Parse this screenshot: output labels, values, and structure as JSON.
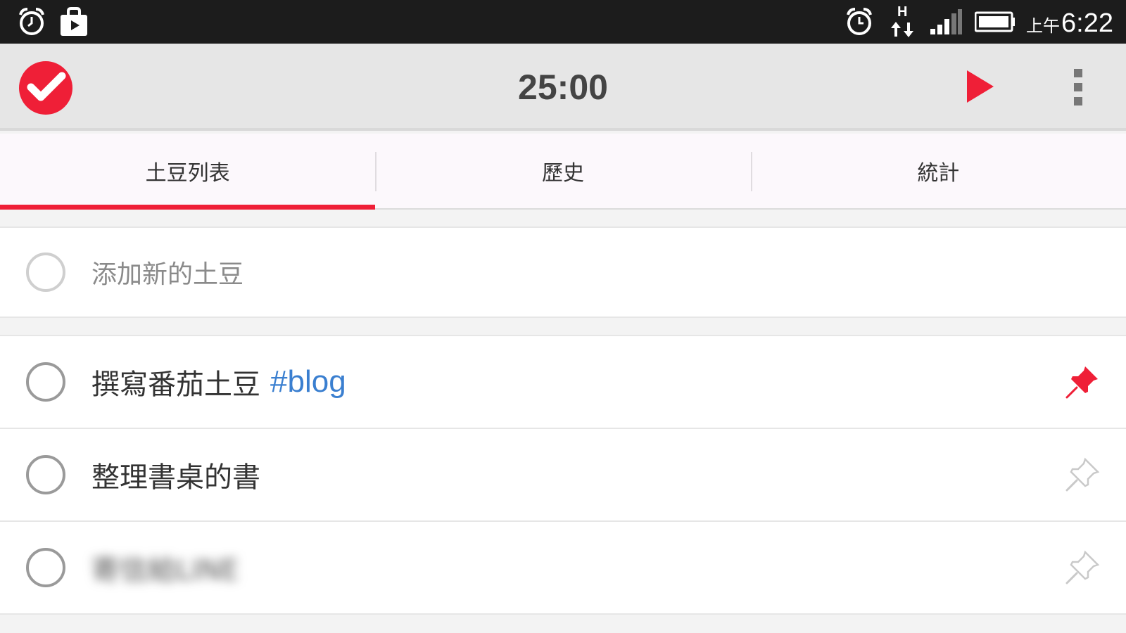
{
  "status_bar": {
    "ampm": "上午",
    "time": "6:22",
    "icons": [
      "alarm-icon",
      "store-bag-icon",
      "alarm-clock-icon",
      "h-data-arrows-icon",
      "signal-bars-icon",
      "battery-icon"
    ]
  },
  "action_bar": {
    "timer": "25:00",
    "accent_color": "#ef1f37"
  },
  "tabs": [
    {
      "label": "土豆列表",
      "active": true
    },
    {
      "label": "歷史",
      "active": false
    },
    {
      "label": "統計",
      "active": false
    }
  ],
  "add_task": {
    "placeholder": "添加新的土豆"
  },
  "tasks": [
    {
      "title": "撰寫番茄土豆",
      "tag": "#blog",
      "pinned": true
    },
    {
      "title": "整理書桌的書",
      "tag": "",
      "pinned": false
    },
    {
      "title": "寄信給LINE",
      "tag": "",
      "pinned": false,
      "blurred": true
    }
  ],
  "colors": {
    "accent": "#ef1f37",
    "tag": "#3a7fd0",
    "statusbar": "#1c1c1c",
    "actionbar": "#e6e6e6"
  }
}
